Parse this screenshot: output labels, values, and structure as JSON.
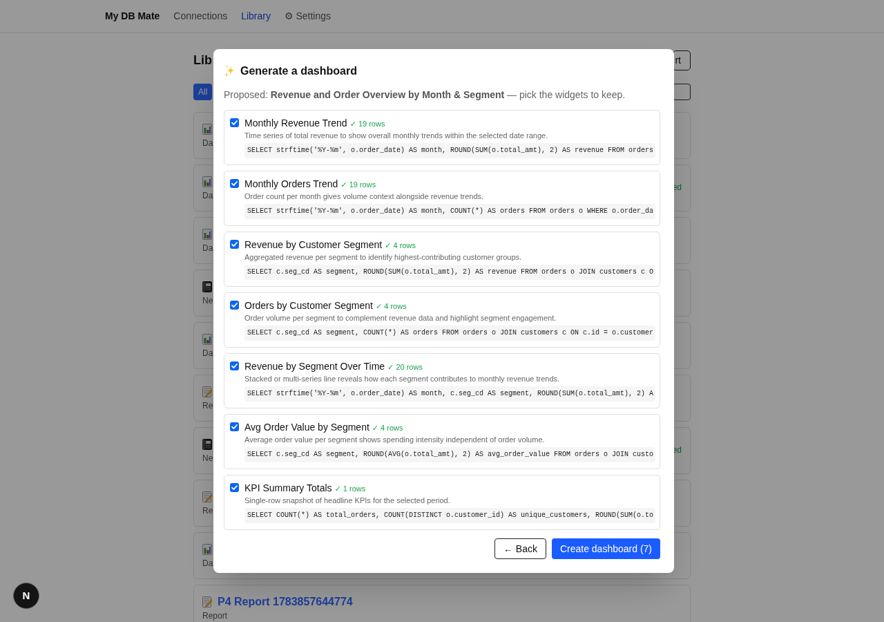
{
  "nav": {
    "brand": "My DB Mate",
    "items": [
      {
        "label": "Connections",
        "selected": false
      },
      {
        "label": "Library",
        "selected": true
      },
      {
        "label": "⚙ Settings",
        "selected": false
      }
    ]
  },
  "library": {
    "heading": "Lib",
    "header_button": "rt",
    "filters": [
      {
        "label": "All",
        "selected": true
      }
    ],
    "items": [
      {
        "kind": "chart",
        "type": "Da"
      },
      {
        "kind": "chart",
        "type": "Da",
        "status": "ed"
      },
      {
        "kind": "chart",
        "type": "Da"
      },
      {
        "kind": "notebook",
        "type": "Ne"
      },
      {
        "kind": "chart",
        "type": "Da"
      },
      {
        "kind": "memo",
        "type": "Re"
      },
      {
        "kind": "notebook",
        "type": "Ne",
        "status": "ed"
      },
      {
        "kind": "memo",
        "type": "Re"
      },
      {
        "kind": "chart",
        "type": "Da"
      },
      {
        "kind": "memo",
        "title": "P4 Report 1783857644774",
        "type": "Report"
      }
    ]
  },
  "dialog": {
    "title": "Generate a dashboard",
    "subtitle": "Proposed: **Revenue and Order Overview by Month & Segment** — pick the widgets to keep.",
    "widgets": [
      {
        "checked": true,
        "title": "Monthly Revenue Trend",
        "rows": "✓ 19 rows",
        "description": "Time series of total revenue to show overall monthly trends within the selected date range.",
        "sql": "SELECT strftime('%Y-%m', o.order_date) AS month, ROUND(SUM(o.total_amt), 2) AS revenue FROM orders"
      },
      {
        "checked": true,
        "title": "Monthly Orders Trend",
        "rows": "✓ 19 rows",
        "description": "Order count per month gives volume context alongside revenue trends.",
        "sql": "SELECT strftime('%Y-%m', o.order_date) AS month, COUNT(*) AS orders FROM orders o WHERE o.order_da"
      },
      {
        "checked": true,
        "title": "Revenue by Customer Segment",
        "rows": "✓ 4 rows",
        "description": "Aggregated revenue per segment to identify highest-contributing customer groups.",
        "sql": "SELECT c.seg_cd AS segment, ROUND(SUM(o.total_amt), 2) AS revenue FROM orders o JOIN customers c O"
      },
      {
        "checked": true,
        "title": "Orders by Customer Segment",
        "rows": "✓ 4 rows",
        "description": "Order volume per segment to complement revenue data and highlight segment engagement.",
        "sql": "SELECT c.seg_cd AS segment, COUNT(*) AS orders FROM orders o JOIN customers c ON c.id = o.customer"
      },
      {
        "checked": true,
        "title": "Revenue by Segment Over Time",
        "rows": "✓ 20 rows",
        "description": "Stacked or multi-series line reveals how each segment contributes to monthly revenue trends.",
        "sql": "SELECT strftime('%Y-%m', o.order_date) AS month, c.seg_cd AS segment, ROUND(SUM(o.total_amt), 2) A"
      },
      {
        "checked": true,
        "title": "Avg Order Value by Segment",
        "rows": "✓ 4 rows",
        "description": "Average order value per segment shows spending intensity independent of order volume.",
        "sql": "SELECT c.seg_cd AS segment, ROUND(AVG(o.total_amt), 2) AS avg_order_value FROM orders o JOIN custo"
      },
      {
        "checked": true,
        "title": "KPI Summary Totals",
        "rows": "✓ 1 rows",
        "description": "Single-row snapshot of headline KPIs for the selected period.",
        "sql": "SELECT COUNT(*) AS total_orders, COUNT(DISTINCT o.customer_id) AS unique_customers, ROUND(SUM(o.to"
      }
    ],
    "buttons": [
      {
        "kind": "secondary",
        "label": "← Back"
      },
      {
        "kind": "primary",
        "label": "Create dashboard (7)"
      }
    ]
  },
  "dev_badge": {
    "label": "N"
  }
}
